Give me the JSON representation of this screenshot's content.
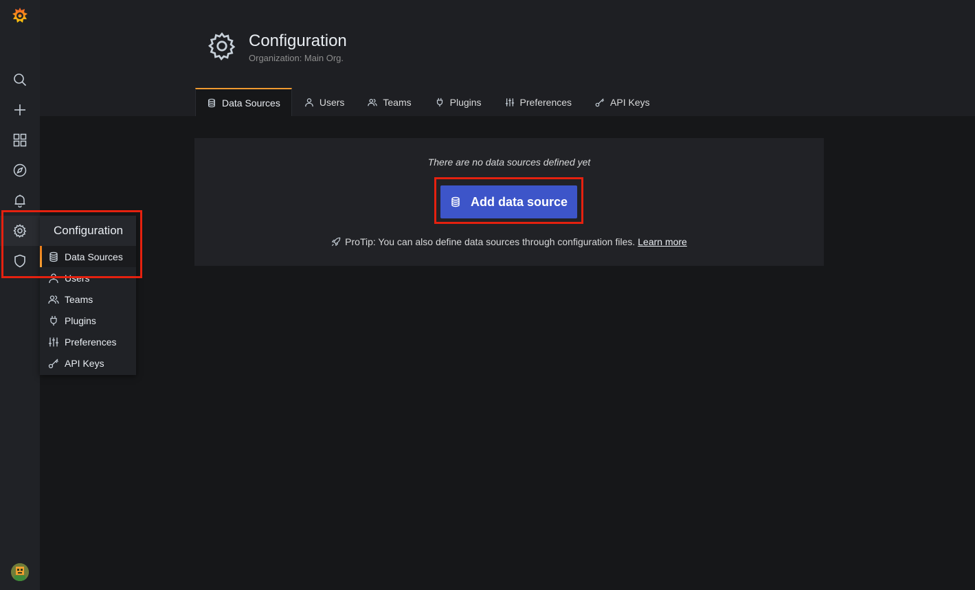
{
  "header": {
    "title": "Configuration",
    "subtitle": "Organization: Main Org."
  },
  "tabs": [
    {
      "label": "Data Sources",
      "icon": "database-icon",
      "active": true
    },
    {
      "label": "Users",
      "icon": "user-icon"
    },
    {
      "label": "Teams",
      "icon": "users-icon"
    },
    {
      "label": "Plugins",
      "icon": "plug-icon"
    },
    {
      "label": "Preferences",
      "icon": "sliders-icon"
    },
    {
      "label": "API Keys",
      "icon": "key-icon"
    }
  ],
  "sidebar": {
    "icons": [
      "grafana-logo-icon",
      "search-icon",
      "plus-icon",
      "dashboards-icon",
      "explore-icon",
      "bell-icon",
      "gear-icon",
      "shield-icon",
      "avatar"
    ]
  },
  "flyout": {
    "title": "Configuration",
    "items": [
      {
        "label": "Data Sources",
        "icon": "database-icon",
        "active": true
      },
      {
        "label": "Users",
        "icon": "user-icon"
      },
      {
        "label": "Teams",
        "icon": "users-icon"
      },
      {
        "label": "Plugins",
        "icon": "plug-icon"
      },
      {
        "label": "Preferences",
        "icon": "sliders-icon"
      },
      {
        "label": "API Keys",
        "icon": "key-icon"
      }
    ]
  },
  "empty_state": {
    "message": "There are no data sources defined yet",
    "button_label": "Add data source",
    "protip": "ProTip: You can also define data sources through configuration files.",
    "protip_link": "Learn more"
  },
  "colors": {
    "accent": "#f19a30",
    "primary_button": "#3d55c9",
    "highlight": "#e5210f"
  }
}
